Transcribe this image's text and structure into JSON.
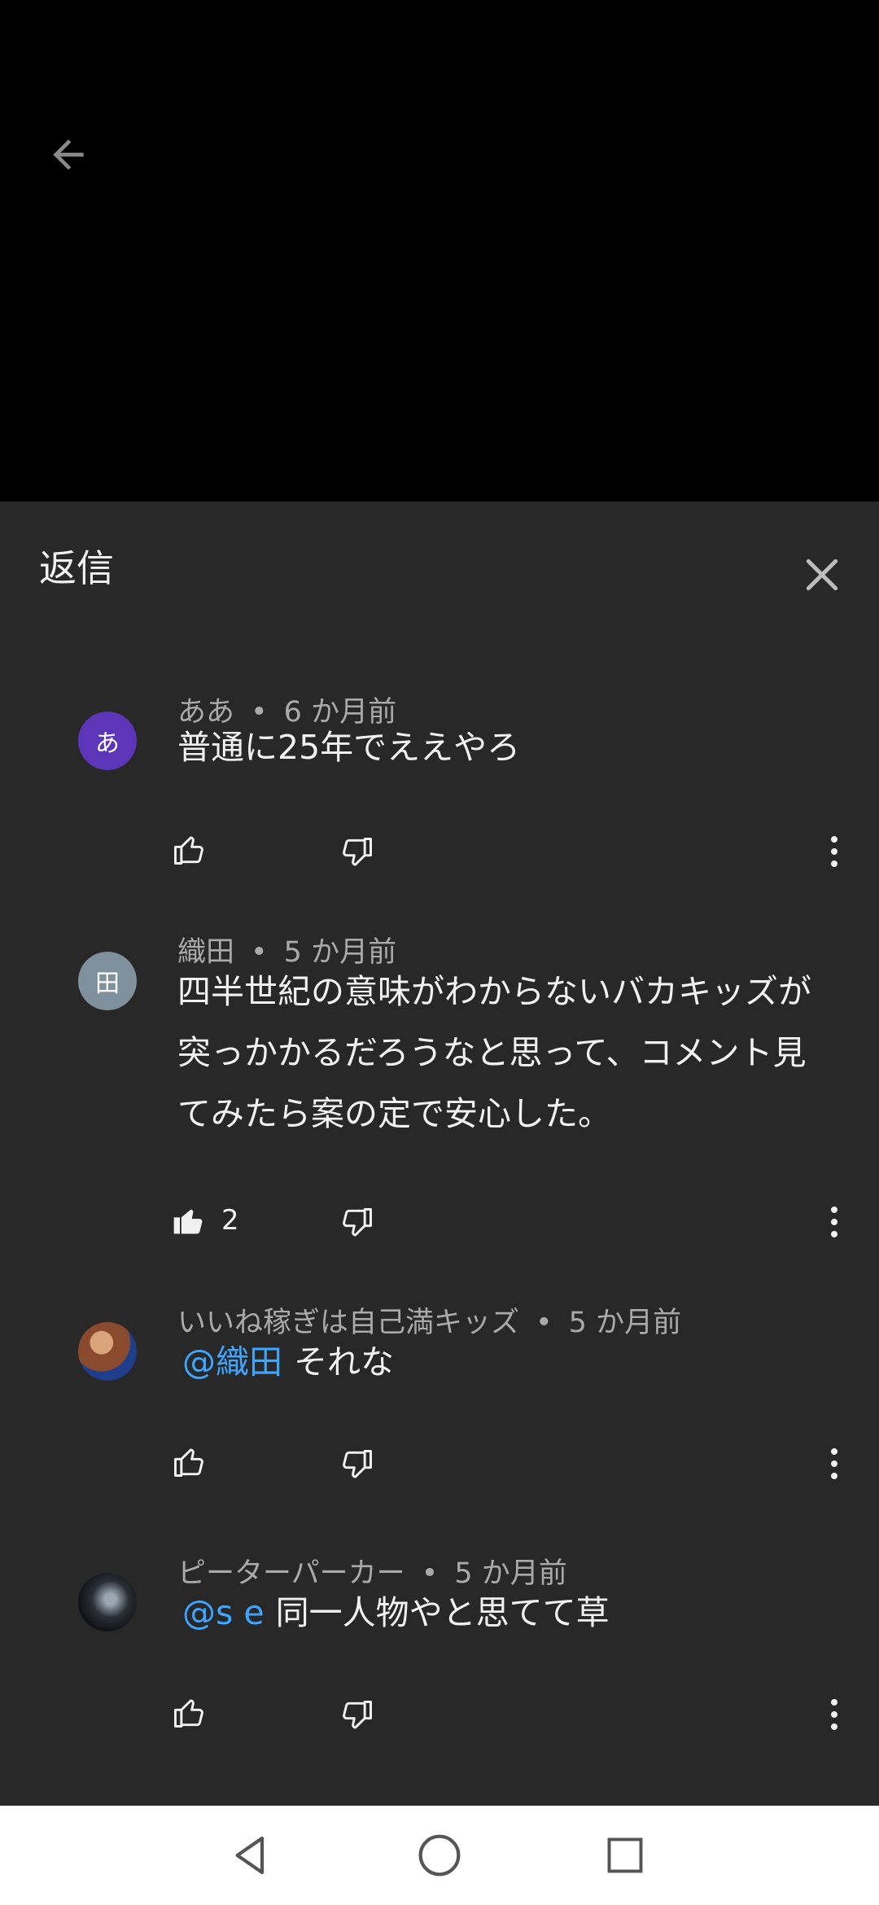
{
  "panel": {
    "title": "返信"
  },
  "comments": [
    {
      "author": "ああ",
      "time": "6 か月前",
      "avatar_text": "あ",
      "avatar_color": "#5c35b8",
      "mention": "",
      "text": "普通に25年でええやろ",
      "likes": ""
    },
    {
      "author": "織田",
      "time": "5 か月前",
      "avatar_text": "田",
      "avatar_color": "#7f919c",
      "mention": "",
      "text": "四半世紀の意味がわからないバカキッズが突っかかるだろうなと思って、コメント見てみたら案の定で安心した。",
      "likes": "2"
    },
    {
      "author": "いいね稼ぎは自己満キッズ",
      "time": "5 か月前",
      "avatar_text": "",
      "avatar_color": "#8a4a2e",
      "mention": "@織田",
      "text": "それな",
      "likes": ""
    },
    {
      "author": "ピーターパーカー",
      "time": "5 か月前",
      "avatar_text": "",
      "avatar_color": "#2b3036",
      "mention": "@s e",
      "text": "同一人物やと思てて草",
      "likes": ""
    }
  ],
  "separator": "•",
  "icons": {
    "back": "arrow-left-icon",
    "close": "close-icon",
    "like": "thumb-up-icon",
    "dislike": "thumb-down-icon",
    "more": "more-vert-icon"
  },
  "nav": {
    "back": "nav-back-icon",
    "home": "nav-home-icon",
    "recents": "nav-recents-icon"
  }
}
